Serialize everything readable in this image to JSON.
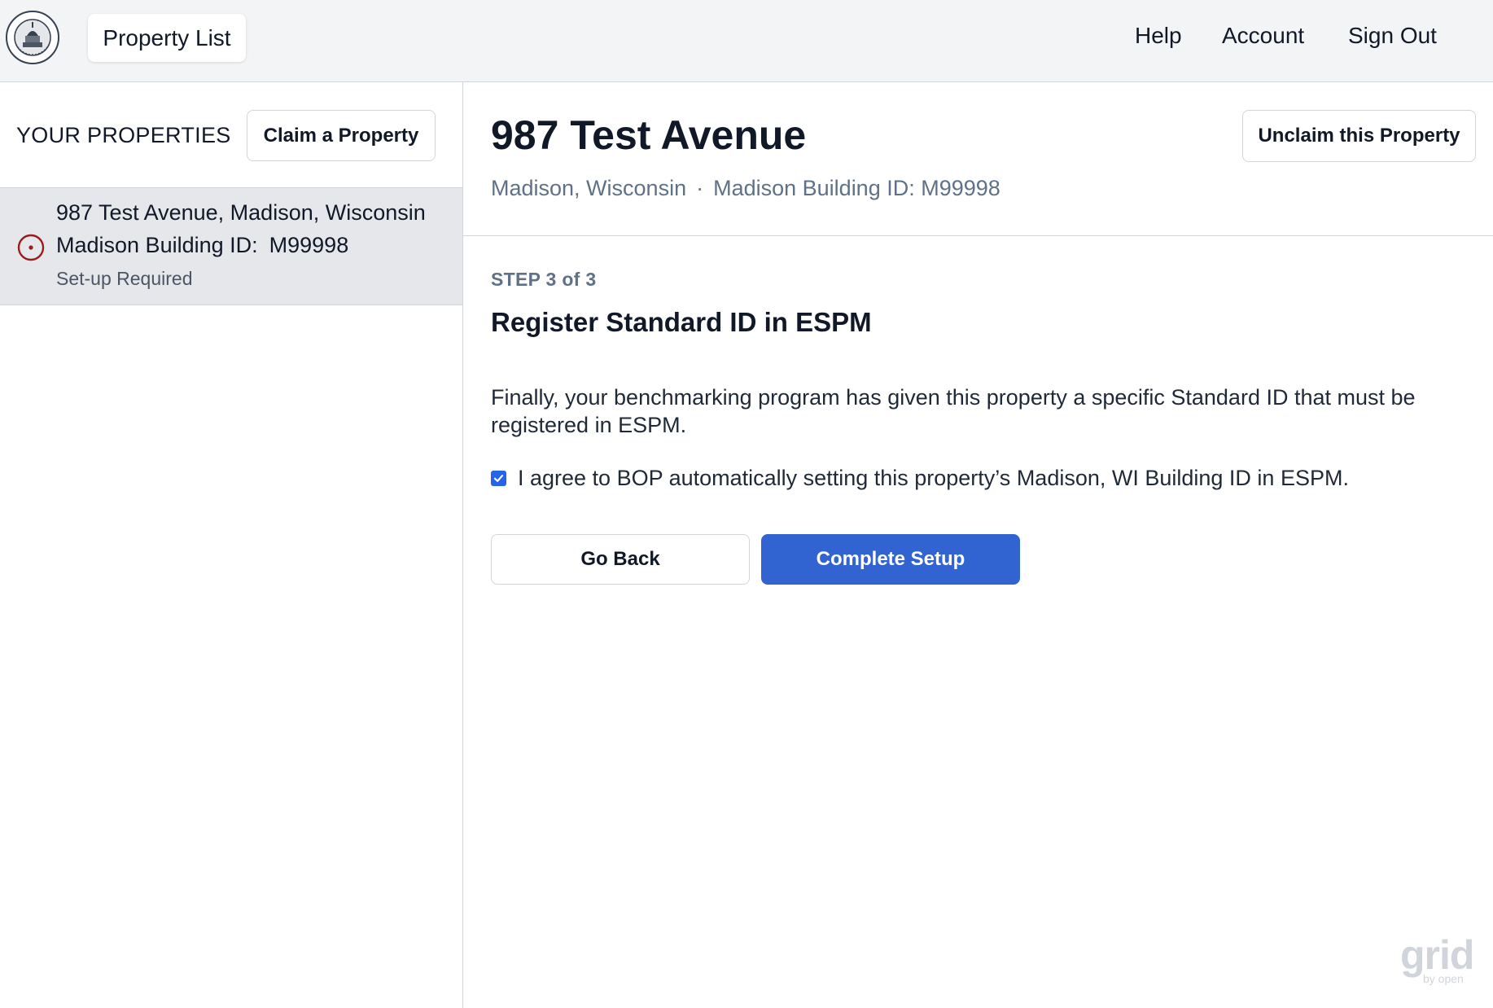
{
  "header": {
    "logo_text_top": "CITY OF MADISON",
    "logo_text_bottom": "WISCONSIN",
    "nav_pill_label": "Property List",
    "links": [
      "Help",
      "Account",
      "Sign Out"
    ]
  },
  "sidebar": {
    "title": "YOUR PROPERTIES",
    "claim_button_label": "Claim a Property",
    "properties": [
      {
        "address": "987 Test Avenue, Madison, Wisconsin",
        "id_label": "Madison Building ID:",
        "id_value": "M99998",
        "status": "Set-up Required",
        "status_icon": "target-circle-icon",
        "status_color": "#9b1c1c"
      }
    ]
  },
  "main": {
    "title": "987 Test Avenue",
    "location": "Madison, Wisconsin",
    "separator": "·",
    "building_id": "Madison Building ID: M99998",
    "unclaim_button_label": "Unclaim this Property",
    "step_label": "STEP 3 of 3",
    "step_heading": "Register Standard ID in ESPM",
    "description": "Finally, your benchmarking program has given this property a specific Standard ID that must be registered in ESPM.",
    "agreement_checked": true,
    "agreement_text": "I agree to BOP automatically setting this property’s Madison, WI Building ID in ESPM.",
    "go_back_label": "Go Back",
    "complete_label": "Complete Setup"
  },
  "watermark": {
    "brand": "grid",
    "byline": "by open"
  },
  "colors": {
    "accent": "#3164d0",
    "checkbox": "#2563eb",
    "muted_text": "#5f7186",
    "topbar_bg": "#f3f4f6",
    "selected_bg": "#e5e7eb"
  }
}
